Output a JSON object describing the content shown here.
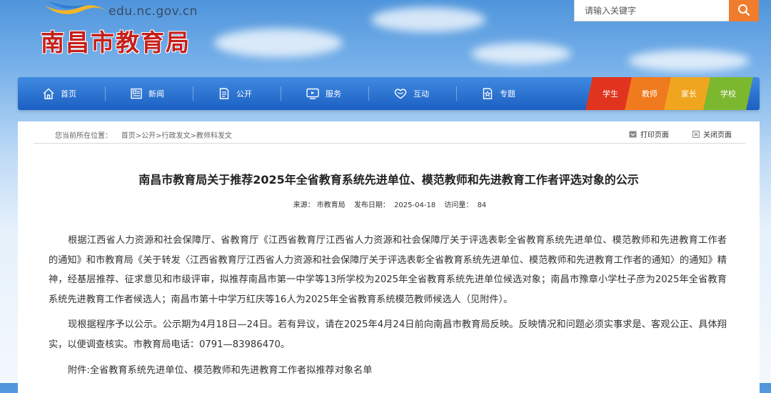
{
  "header": {
    "site_url": "edu.nc.gov.cn",
    "site_title": "南昌市教育局",
    "search": {
      "placeholder": "请输入关键字"
    }
  },
  "nav": {
    "items": [
      {
        "label": "首页",
        "icon": "home-icon"
      },
      {
        "label": "新闻",
        "icon": "newspaper-icon"
      },
      {
        "label": "公开",
        "icon": "document-list-icon"
      },
      {
        "label": "服务",
        "icon": "monitor-service-icon"
      },
      {
        "label": "互动",
        "icon": "heart-chat-icon"
      },
      {
        "label": "专题",
        "icon": "star-document-icon"
      }
    ],
    "roles": [
      {
        "label": "学生",
        "color": "#e0341f"
      },
      {
        "label": "教师",
        "color": "#f07a1e"
      },
      {
        "label": "家长",
        "color": "#f0a51e"
      },
      {
        "label": "学校",
        "color": "#7cb82f"
      }
    ]
  },
  "breadcrumb": {
    "prefix": "您当前所在位置：",
    "items": [
      "首页",
      "公开",
      "行政发文",
      "教师科发文"
    ]
  },
  "tools": {
    "print": "打印页面",
    "close": "关闭页面"
  },
  "article": {
    "title": "南昌市教育局关于推荐2025年全省教育系统先进单位、模范教师和先进教育工作者评选对象的公示",
    "meta": {
      "source_label": "来源：",
      "source": "市教育局",
      "date_label": "发布日期：",
      "date": "2025-04-18",
      "views_label": "访问量：",
      "views": "84"
    },
    "paragraphs": [
      "根据江西省人力资源和社会保障厅、省教育厅《江西省教育厅江西省人力资源和社会保障厅关于评选表彰全省教育系统先进单位、模范教师和先进教育工作者的通知》和市教育局《关于转发〈江西省教育厅江西省人力资源和社会保障厅关于评选表彰全省教育系统先进单位、模范教师和先进教育工作者的通知〉的通知》精神，经基层推荐、征求意见和市级评审，拟推荐南昌市第一中学等13所学校为2025年全省教育系统先进单位候选对象；南昌市豫章小学杜子彦为2025年全省教育系统先进教育工作者候选人；南昌市第十中学万红庆等16人为2025年全省教育系统模范教师候选人（见附件）。",
      "现根据程序予以公示。公示期为4月18日—24日。若有异议，请在2025年4月24日前向南昌市教育局反映。反映情况和问题必须实事求是、客观公正、具体翔实，以便调查核实。市教育局电话：0791—83986470。",
      "附件:全省教育系统先进单位、模范教师和先进教育工作者拟推荐对象名单"
    ]
  }
}
